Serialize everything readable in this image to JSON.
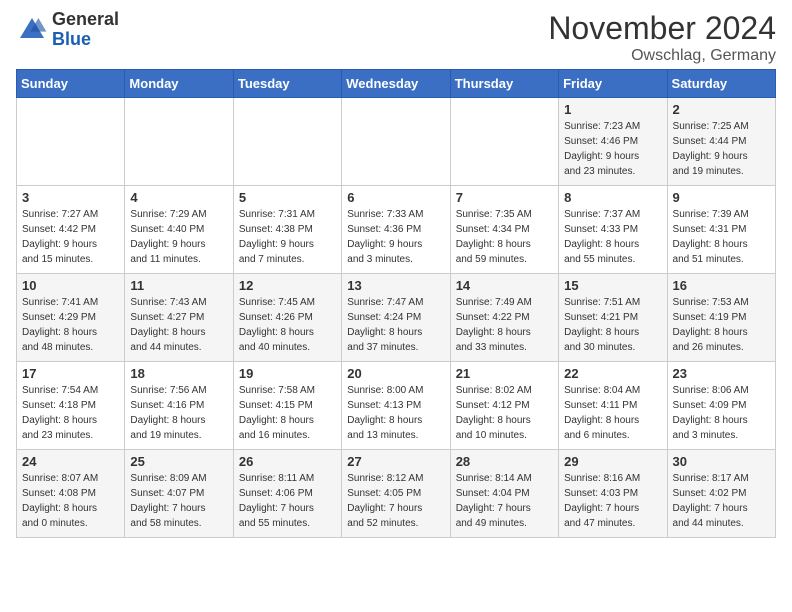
{
  "logo": {
    "general": "General",
    "blue": "Blue"
  },
  "title": "November 2024",
  "location": "Owschlag, Germany",
  "days_of_week": [
    "Sunday",
    "Monday",
    "Tuesday",
    "Wednesday",
    "Thursday",
    "Friday",
    "Saturday"
  ],
  "weeks": [
    [
      {
        "day": "",
        "info": ""
      },
      {
        "day": "",
        "info": ""
      },
      {
        "day": "",
        "info": ""
      },
      {
        "day": "",
        "info": ""
      },
      {
        "day": "",
        "info": ""
      },
      {
        "day": "1",
        "info": "Sunrise: 7:23 AM\nSunset: 4:46 PM\nDaylight: 9 hours\nand 23 minutes."
      },
      {
        "day": "2",
        "info": "Sunrise: 7:25 AM\nSunset: 4:44 PM\nDaylight: 9 hours\nand 19 minutes."
      }
    ],
    [
      {
        "day": "3",
        "info": "Sunrise: 7:27 AM\nSunset: 4:42 PM\nDaylight: 9 hours\nand 15 minutes."
      },
      {
        "day": "4",
        "info": "Sunrise: 7:29 AM\nSunset: 4:40 PM\nDaylight: 9 hours\nand 11 minutes."
      },
      {
        "day": "5",
        "info": "Sunrise: 7:31 AM\nSunset: 4:38 PM\nDaylight: 9 hours\nand 7 minutes."
      },
      {
        "day": "6",
        "info": "Sunrise: 7:33 AM\nSunset: 4:36 PM\nDaylight: 9 hours\nand 3 minutes."
      },
      {
        "day": "7",
        "info": "Sunrise: 7:35 AM\nSunset: 4:34 PM\nDaylight: 8 hours\nand 59 minutes."
      },
      {
        "day": "8",
        "info": "Sunrise: 7:37 AM\nSunset: 4:33 PM\nDaylight: 8 hours\nand 55 minutes."
      },
      {
        "day": "9",
        "info": "Sunrise: 7:39 AM\nSunset: 4:31 PM\nDaylight: 8 hours\nand 51 minutes."
      }
    ],
    [
      {
        "day": "10",
        "info": "Sunrise: 7:41 AM\nSunset: 4:29 PM\nDaylight: 8 hours\nand 48 minutes."
      },
      {
        "day": "11",
        "info": "Sunrise: 7:43 AM\nSunset: 4:27 PM\nDaylight: 8 hours\nand 44 minutes."
      },
      {
        "day": "12",
        "info": "Sunrise: 7:45 AM\nSunset: 4:26 PM\nDaylight: 8 hours\nand 40 minutes."
      },
      {
        "day": "13",
        "info": "Sunrise: 7:47 AM\nSunset: 4:24 PM\nDaylight: 8 hours\nand 37 minutes."
      },
      {
        "day": "14",
        "info": "Sunrise: 7:49 AM\nSunset: 4:22 PM\nDaylight: 8 hours\nand 33 minutes."
      },
      {
        "day": "15",
        "info": "Sunrise: 7:51 AM\nSunset: 4:21 PM\nDaylight: 8 hours\nand 30 minutes."
      },
      {
        "day": "16",
        "info": "Sunrise: 7:53 AM\nSunset: 4:19 PM\nDaylight: 8 hours\nand 26 minutes."
      }
    ],
    [
      {
        "day": "17",
        "info": "Sunrise: 7:54 AM\nSunset: 4:18 PM\nDaylight: 8 hours\nand 23 minutes."
      },
      {
        "day": "18",
        "info": "Sunrise: 7:56 AM\nSunset: 4:16 PM\nDaylight: 8 hours\nand 19 minutes."
      },
      {
        "day": "19",
        "info": "Sunrise: 7:58 AM\nSunset: 4:15 PM\nDaylight: 8 hours\nand 16 minutes."
      },
      {
        "day": "20",
        "info": "Sunrise: 8:00 AM\nSunset: 4:13 PM\nDaylight: 8 hours\nand 13 minutes."
      },
      {
        "day": "21",
        "info": "Sunrise: 8:02 AM\nSunset: 4:12 PM\nDaylight: 8 hours\nand 10 minutes."
      },
      {
        "day": "22",
        "info": "Sunrise: 8:04 AM\nSunset: 4:11 PM\nDaylight: 8 hours\nand 6 minutes."
      },
      {
        "day": "23",
        "info": "Sunrise: 8:06 AM\nSunset: 4:09 PM\nDaylight: 8 hours\nand 3 minutes."
      }
    ],
    [
      {
        "day": "24",
        "info": "Sunrise: 8:07 AM\nSunset: 4:08 PM\nDaylight: 8 hours\nand 0 minutes."
      },
      {
        "day": "25",
        "info": "Sunrise: 8:09 AM\nSunset: 4:07 PM\nDaylight: 7 hours\nand 58 minutes."
      },
      {
        "day": "26",
        "info": "Sunrise: 8:11 AM\nSunset: 4:06 PM\nDaylight: 7 hours\nand 55 minutes."
      },
      {
        "day": "27",
        "info": "Sunrise: 8:12 AM\nSunset: 4:05 PM\nDaylight: 7 hours\nand 52 minutes."
      },
      {
        "day": "28",
        "info": "Sunrise: 8:14 AM\nSunset: 4:04 PM\nDaylight: 7 hours\nand 49 minutes."
      },
      {
        "day": "29",
        "info": "Sunrise: 8:16 AM\nSunset: 4:03 PM\nDaylight: 7 hours\nand 47 minutes."
      },
      {
        "day": "30",
        "info": "Sunrise: 8:17 AM\nSunset: 4:02 PM\nDaylight: 7 hours\nand 44 minutes."
      }
    ]
  ]
}
